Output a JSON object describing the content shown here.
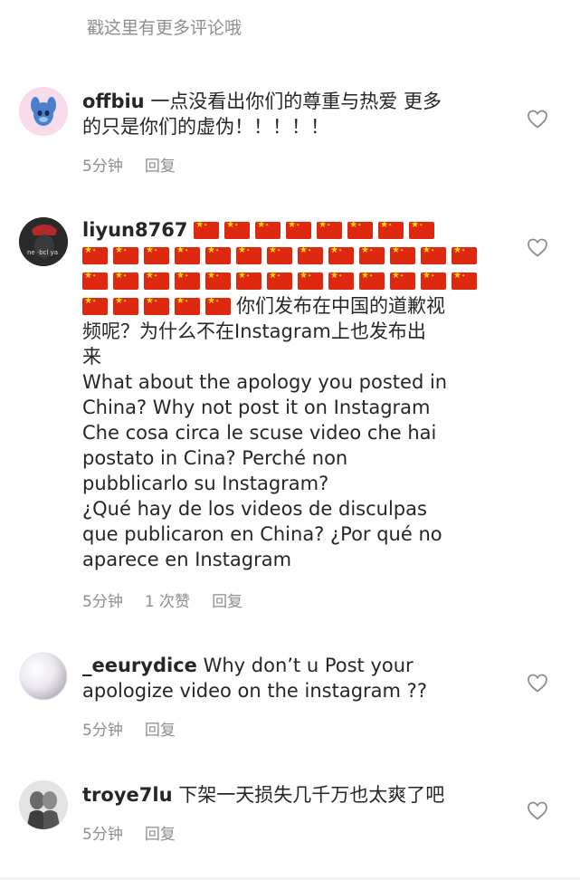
{
  "header": {
    "more_comments_label": "戳这里有更多评论哦"
  },
  "comments": [
    {
      "username": "offbiu",
      "text": "一点没看出你们的尊重与热爱 更多的只是你们的虚伪！！！！！",
      "line1": "一点没看出你们的尊重与热爱 更多",
      "line2": "的只是你们的虚伪！！！！！",
      "time": "5分钟",
      "reply_label": "回复"
    },
    {
      "username": "liyun8767",
      "flag_rows": [
        8,
        13,
        13,
        5
      ],
      "text_lines": [
        "你们发布在中国的道歉视",
        "频呢？为什么不在Instagram上也发布出",
        "来",
        "What about the apology you posted in",
        "China? Why not post it on Instagram",
        "Che cosa circa le scuse video che hai",
        "postato in Cina? Perché non",
        "pubblicarlo su Instagram?",
        "¿Qué hay de los videos de disculpas",
        "que publicaron en China? ¿Por qué no",
        "aparece en Instagram"
      ],
      "time": "5分钟",
      "likes": "1 次赞",
      "reply_label": "回复"
    },
    {
      "username": "_eeurydice",
      "line1": "Why don’t u Post your",
      "line2": "apologize video on the instagram ??",
      "time": "5分钟",
      "reply_label": "回复"
    },
    {
      "username": "troye7lu",
      "line1": "下架一天损失几千万也太爽了吧",
      "time": "5分钟",
      "reply_label": "回复"
    }
  ],
  "icons": {
    "like": "heart-outline-icon",
    "flag": "china-flag-emoji"
  },
  "colors": {
    "secondary_text": "#8e8e8e",
    "primary_text": "#262626",
    "flag_red": "#de2910",
    "flag_yellow": "#ffde00"
  }
}
